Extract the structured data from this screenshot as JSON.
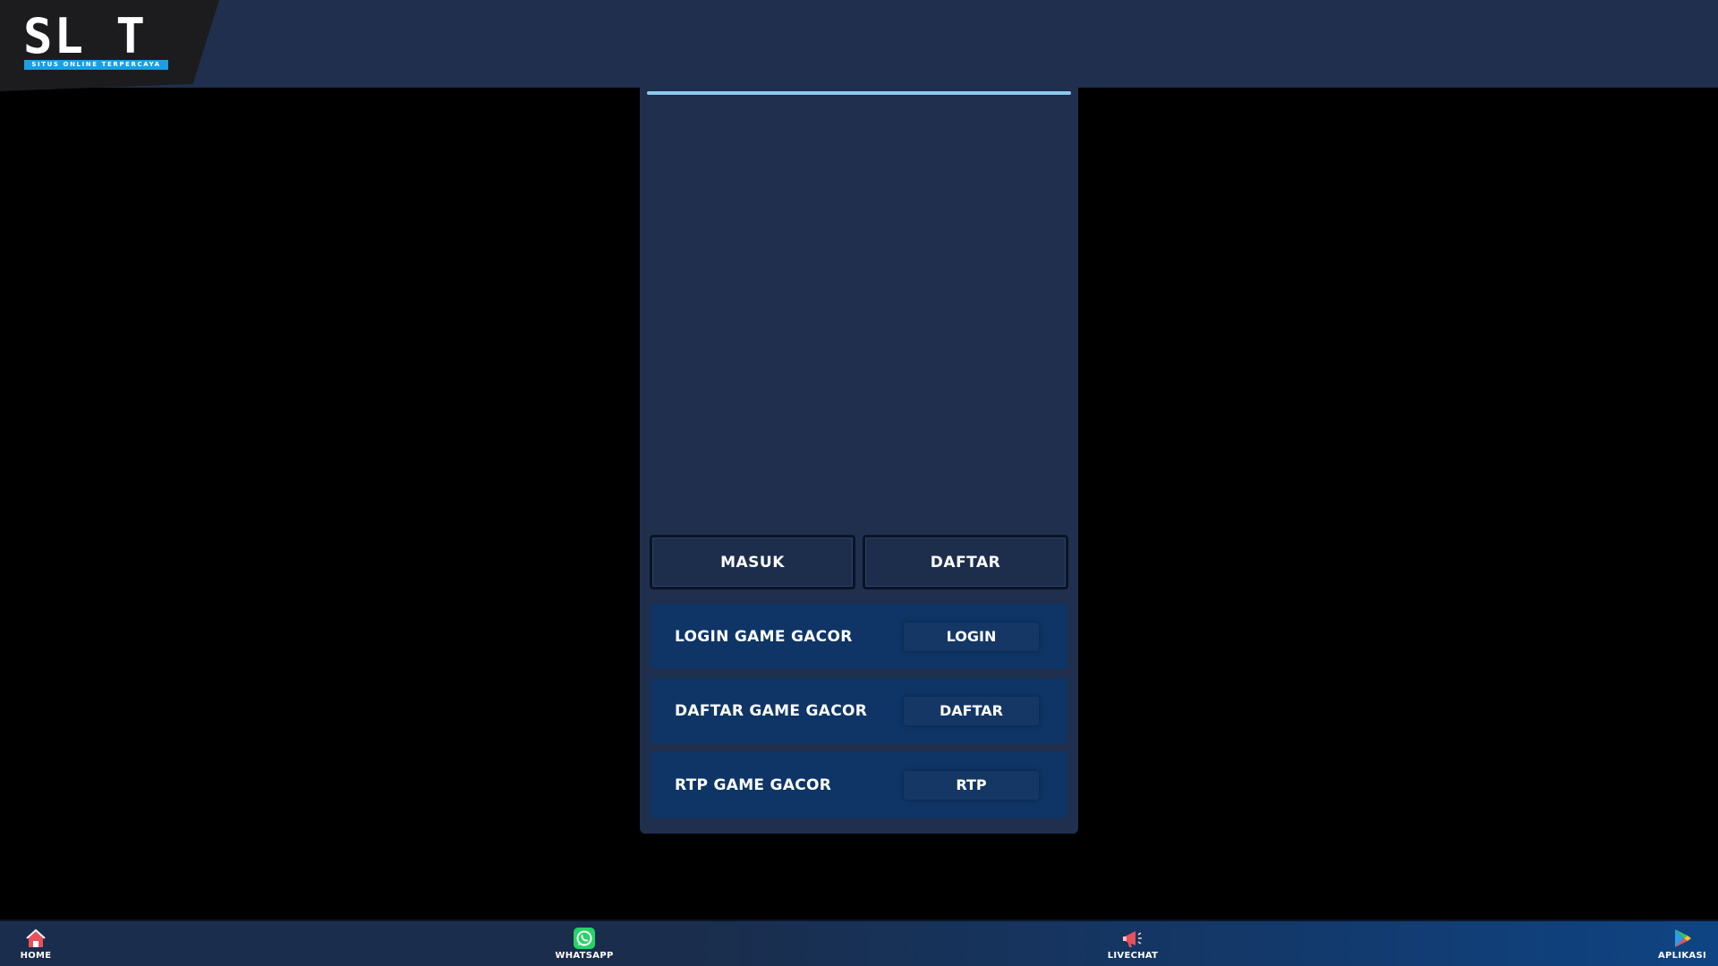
{
  "header": {
    "logo_text": "SL T",
    "logo_tagline": "SITUS ONLINE TERPERCAYA"
  },
  "auth": {
    "login_label": "MASUK",
    "register_label": "DAFTAR"
  },
  "cards": [
    {
      "label": "LOGIN GAME GACOR",
      "button": "LOGIN"
    },
    {
      "label": "DAFTAR GAME GACOR",
      "button": "DAFTAR"
    },
    {
      "label": "RTP GAME GACOR",
      "button": "RTP"
    }
  ],
  "bottom_nav": [
    {
      "label": "HOME",
      "icon": "home-icon"
    },
    {
      "label": "WHATSAPP",
      "icon": "whatsapp-icon"
    },
    {
      "label": "LIVECHAT",
      "icon": "megaphone-icon"
    },
    {
      "label": "APLIKASI",
      "icon": "play-store-icon"
    }
  ],
  "colors": {
    "page_background": "#000000",
    "header_background": "#1f2f4d",
    "card_background": "#0e3566",
    "accent_line": "#8fc8ee",
    "tagline_background": "#1aa0e0"
  }
}
